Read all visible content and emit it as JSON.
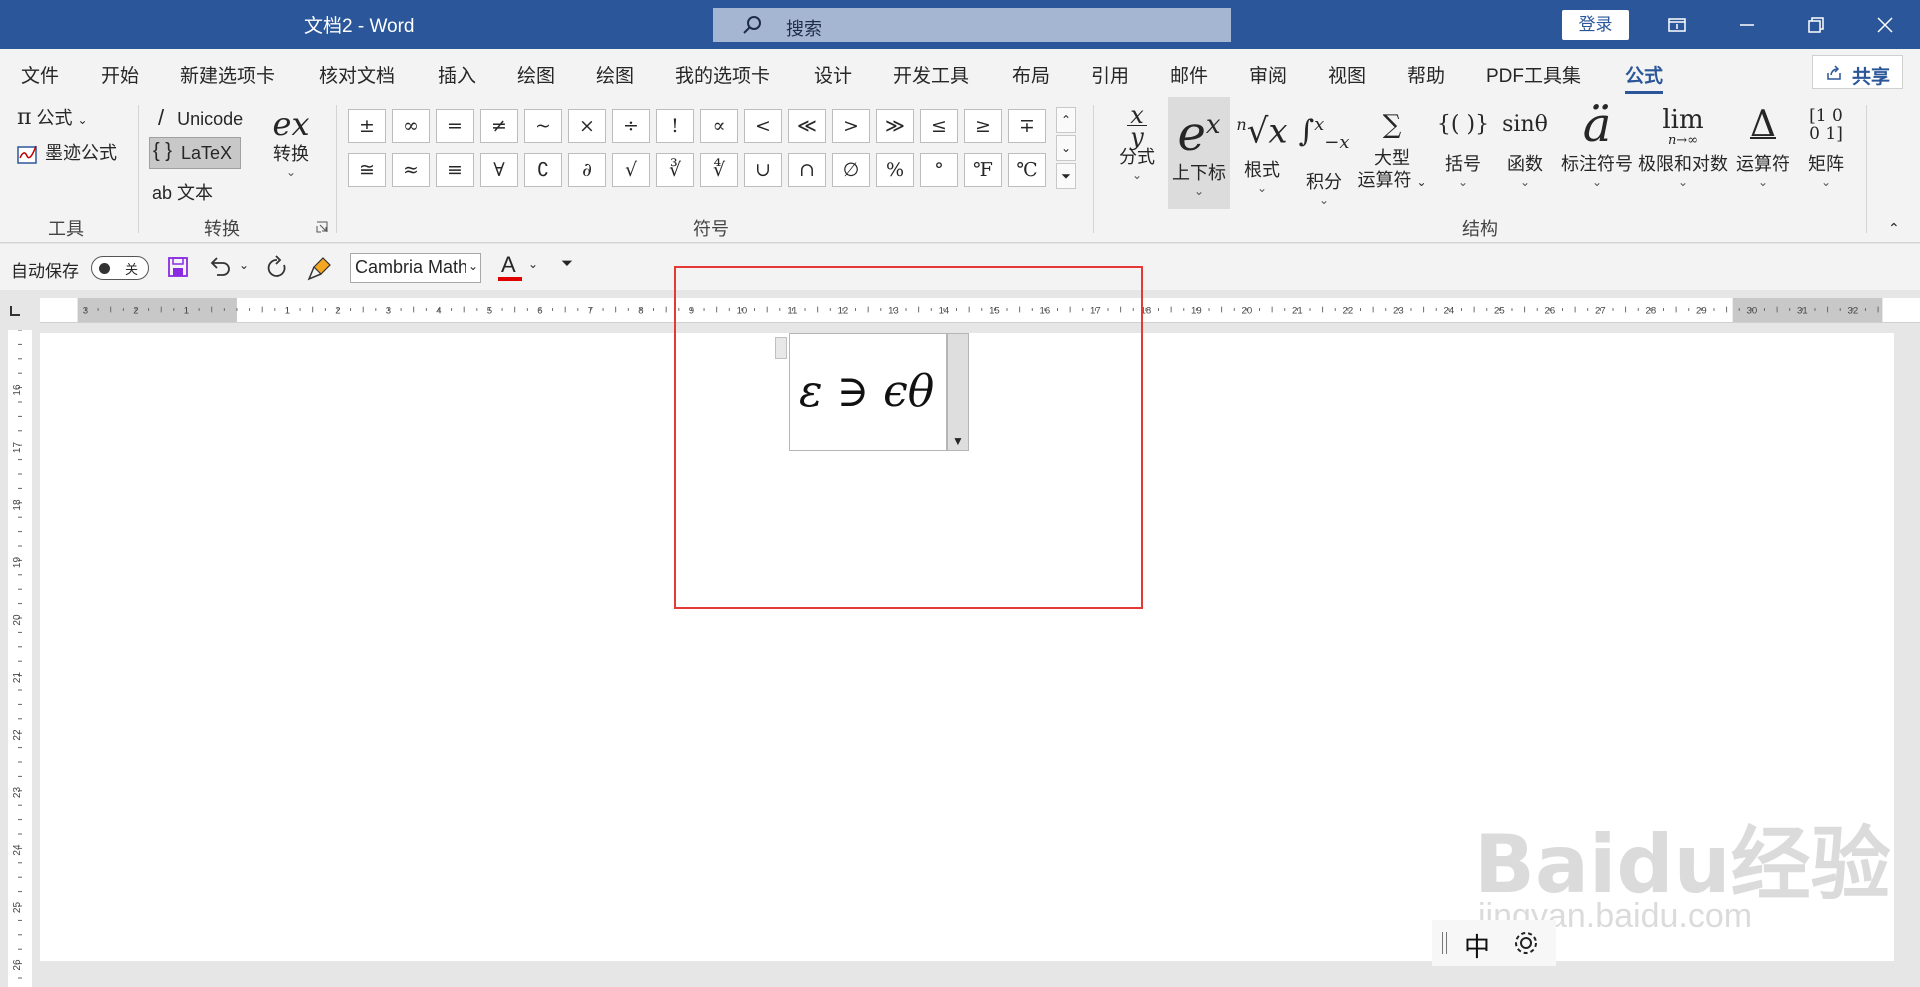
{
  "titlebar": {
    "doc_title": "文档2  -  Word",
    "search": "搜索",
    "login": "登录"
  },
  "tabs": [
    "文件",
    "开始",
    "新建选项卡",
    "核对文档",
    "插入",
    "绘图",
    "绘图",
    "我的选项卡",
    "设计",
    "开发工具",
    "布局",
    "引用",
    "邮件",
    "审阅",
    "视图",
    "帮助",
    "PDF工具集",
    "公式"
  ],
  "active_tab": "公式",
  "share": "共享",
  "ribbon": {
    "tools": {
      "formula": "公式",
      "ink_formula": "墨迹公式",
      "group": "工具"
    },
    "convert": {
      "unicode": "Unicode",
      "latex": "LaTeX",
      "text": "文本",
      "convert_btn": "转换",
      "convert_glyph": "ex",
      "group": "转换"
    },
    "symbols": {
      "row1": [
        "±",
        "∞",
        "=",
        "≠",
        "~",
        "×",
        "÷",
        "!",
        "∝",
        "<",
        "≪",
        ">",
        "≫",
        "≤",
        "≥",
        "∓"
      ],
      "row2": [
        "≅",
        "≈",
        "≡",
        "∀",
        "∁",
        "∂",
        "√",
        "∛",
        "∜",
        "∪",
        "∩",
        "∅",
        "%",
        "°",
        "℉",
        "℃"
      ],
      "group": "符号"
    },
    "structures": {
      "fraction": "分式",
      "script": "上下标",
      "radical": "根式",
      "integral": "积分",
      "large_op_1": "大型",
      "large_op_2": "运算符",
      "bracket": "括号",
      "function": "函数",
      "function_glyph": "sinθ",
      "accent": "标注符号",
      "accent_glyph": "ä",
      "limit": "极限和对数",
      "limit_glyph": "lim",
      "limit_sub": "n→∞",
      "operator": "运算符",
      "matrix": "矩阵",
      "group": "结构"
    }
  },
  "qat": {
    "autosave": "自动保存",
    "autosave_state": "关",
    "font": "Cambria Math"
  },
  "document": {
    "equation": "ε ∋ ϵθ"
  },
  "ime": {
    "mode": "中"
  },
  "watermark": {
    "main": "Baidu经验",
    "sub": "jingyan.baidu.com"
  },
  "colors": {
    "brand": "#2b579a",
    "highlight": "#e53935"
  }
}
